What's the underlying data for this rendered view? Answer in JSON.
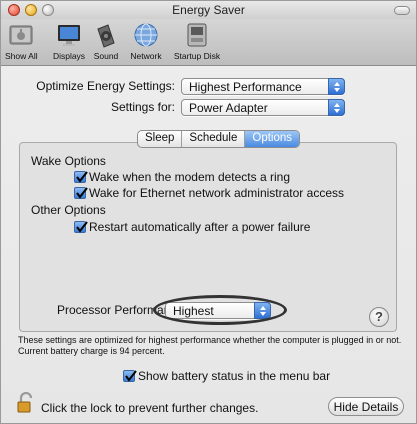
{
  "window": {
    "title": "Energy Saver"
  },
  "toolbar": {
    "items": [
      {
        "label": "Show All",
        "icon": "apple-icon"
      },
      {
        "label": "Displays",
        "icon": "display-icon"
      },
      {
        "label": "Sound",
        "icon": "speaker-icon"
      },
      {
        "label": "Network",
        "icon": "network-icon"
      },
      {
        "label": "Startup Disk",
        "icon": "disk-icon"
      }
    ]
  },
  "settings": {
    "optimize_label": "Optimize Energy Settings:",
    "optimize_value": "Highest Performance",
    "for_label": "Settings for:",
    "for_value": "Power Adapter"
  },
  "tabs": [
    {
      "label": "Sleep",
      "active": false
    },
    {
      "label": "Schedule",
      "active": false
    },
    {
      "label": "Options",
      "active": true
    }
  ],
  "options": {
    "wake_heading": "Wake Options",
    "wake_modem": "Wake when the modem detects a ring",
    "wake_ethernet": "Wake for Ethernet network administrator access",
    "other_heading": "Other Options",
    "restart": "Restart automatically after a power failure",
    "processor_label": "Processor Performanc",
    "processor_value": "Highest",
    "help": "?"
  },
  "footer": {
    "info_line1": "These settings are optimized for highest performance whether the computer is plugged in or not.",
    "info_line2": "Current battery charge is 94 percent.",
    "battery_status": "Show battery status in the menu bar",
    "lock_text": "Click the lock to prevent further changes.",
    "hide_details": "Hide Details"
  },
  "colors": {
    "accent": "#3a7bd6",
    "window_bg": "#e6e6e6"
  }
}
